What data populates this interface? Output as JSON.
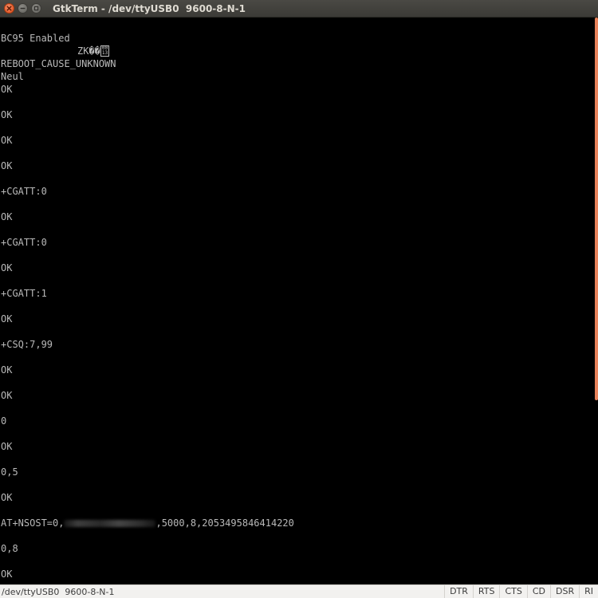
{
  "window": {
    "title": "GtkTerm - /dev/ttyUSB0  9600-8-N-1"
  },
  "terminal": {
    "lines": [
      "BC95 Enabled",
      "ZK��",
      "REBOOT_CAUSE_UNKNOWN",
      "Neul",
      "OK",
      "",
      "OK",
      "",
      "OK",
      "",
      "OK",
      "",
      "+CGATT:0",
      "",
      "OK",
      "",
      "+CGATT:0",
      "",
      "OK",
      "",
      "+CGATT:1",
      "",
      "OK",
      "",
      "+CSQ:7,99",
      "",
      "OK",
      "",
      "OK",
      "",
      "0",
      "",
      "OK",
      "",
      "0,5",
      "",
      "OK",
      "",
      "",
      "",
      "0,8",
      "",
      "OK"
    ],
    "hex_glyph": [
      "00",
      "13"
    ],
    "nsost": {
      "prefix": "AT+NSOST=0,",
      "suffix": ",5000,8,2053495846414220"
    }
  },
  "statusbar": {
    "port": "/dev/ttyUSB0  9600-8-N-1",
    "signals": [
      "DTR",
      "RTS",
      "CTS",
      "CD",
      "DSR",
      "RI"
    ]
  },
  "colors": {
    "close_button": "#df4a16",
    "scrollbar_thumb": "#e8825a",
    "terminal_text": "#b9b9b9"
  }
}
